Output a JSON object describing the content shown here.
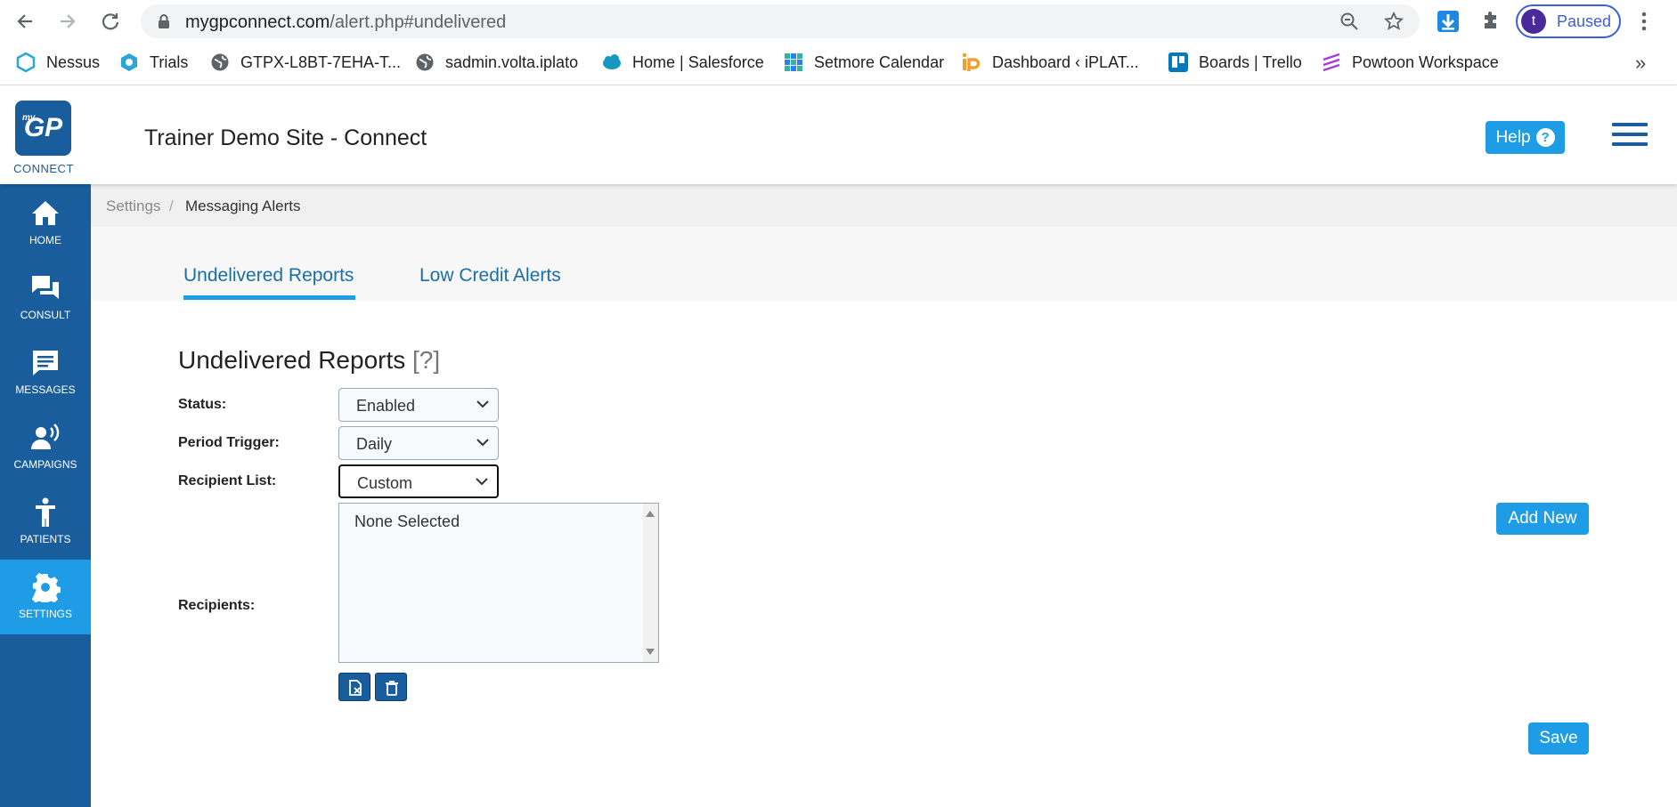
{
  "browser": {
    "url_domain": "mygpconnect.com",
    "url_path": "/alert.php#undelivered",
    "profile_initial": "t",
    "profile_status": "Paused",
    "bookmarks": [
      {
        "label": "Nessus",
        "icon": "nessus-icon"
      },
      {
        "label": "Trials",
        "icon": "trials-icon"
      },
      {
        "label": "GTPX-L8BT-7EHA-T...",
        "icon": "globe-icon"
      },
      {
        "label": "sadmin.volta.iplato",
        "icon": "globe-icon"
      },
      {
        "label": "Home | Salesforce",
        "icon": "salesforce-icon"
      },
      {
        "label": "Setmore Calendar",
        "icon": "setmore-icon"
      },
      {
        "label": "Dashboard ‹ iPLAT...",
        "icon": "iplato-icon"
      },
      {
        "label": "Boards | Trello",
        "icon": "trello-icon"
      },
      {
        "label": "Powtoon Workspace",
        "icon": "powtoon-icon"
      }
    ],
    "bookmarks_more": "»"
  },
  "header": {
    "logo_my": "my",
    "logo_text": "GP",
    "logo_caption": "CONNECT",
    "site_title": "Trainer Demo Site - Connect",
    "help_label": "Help",
    "help_glyph": "?"
  },
  "sidebar": {
    "items": [
      {
        "label": "HOME",
        "icon": "home-icon"
      },
      {
        "label": "CONSULT",
        "icon": "consult-icon"
      },
      {
        "label": "MESSAGES",
        "icon": "messages-icon"
      },
      {
        "label": "CAMPAIGNS",
        "icon": "campaigns-icon"
      },
      {
        "label": "PATIENTS",
        "icon": "patients-icon"
      },
      {
        "label": "SETTINGS",
        "icon": "settings-icon",
        "active": true
      }
    ]
  },
  "breadcrumb": {
    "parent": "Settings",
    "separator": "/",
    "current": "Messaging Alerts"
  },
  "tabs": [
    {
      "label": "Undelivered Reports",
      "active": true
    },
    {
      "label": "Low Credit Alerts",
      "active": false
    }
  ],
  "panel": {
    "title": "Undelivered Reports",
    "hint": "[?]",
    "status_label": "Status:",
    "status_value": "Enabled",
    "period_label": "Period Trigger:",
    "period_value": "Daily",
    "recipient_list_label": "Recipient List:",
    "recipient_list_value": "Custom",
    "recipients_label": "Recipients:",
    "recipients_options": [
      "None Selected"
    ],
    "add_new_label": "Add New",
    "save_label": "Save"
  },
  "colors": {
    "brand_dark": "#1a5d9c",
    "brand_accent": "#1e9de6"
  }
}
